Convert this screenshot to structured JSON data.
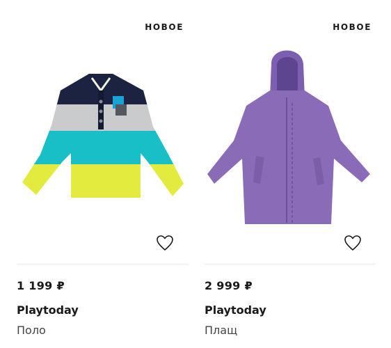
{
  "products": [
    {
      "badge": "НОВОЕ",
      "price": "1 199 ₽",
      "brand": "Playtoday",
      "type": "Поло",
      "image_icon": "striped-polo-shirt",
      "colors": [
        "#1c2340",
        "#c9cbcd",
        "#18bfc6",
        "#e3ec3e"
      ]
    },
    {
      "badge": "НОВОЕ",
      "price": "2 999 ₽",
      "brand": "Playtoday",
      "type": "Плащ",
      "image_icon": "purple-raincoat",
      "colors": [
        "#8a6bb8"
      ]
    }
  ],
  "icons": {
    "favorite": "heart-outline-icon"
  }
}
